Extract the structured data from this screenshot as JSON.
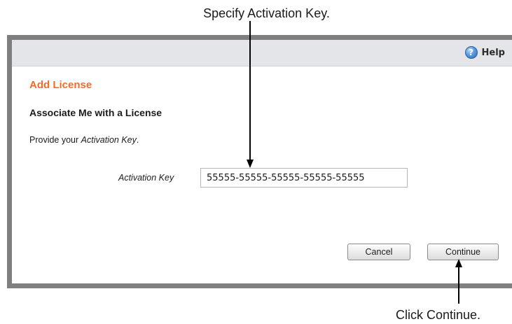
{
  "annotations": {
    "top_callout": "Specify Activation Key.",
    "bottom_callout": "Click Continue."
  },
  "header": {
    "help_label": "Help",
    "help_icon": "help-circle-icon"
  },
  "dialog": {
    "title": "Add License",
    "subheading": "Associate Me with a License",
    "instructions_prefix": "Provide your ",
    "instructions_emphasis": "Activation Key",
    "instructions_suffix": "."
  },
  "form": {
    "activation_key_label": "Activation Key",
    "activation_key_value": "55555-55555-55555-55555-55555"
  },
  "buttons": {
    "cancel_label": "Cancel",
    "continue_label": "Continue"
  },
  "colors": {
    "title_accent": "#f26b2a",
    "frame": "#7f7f7f",
    "header_bg": "#e3e5e9"
  }
}
